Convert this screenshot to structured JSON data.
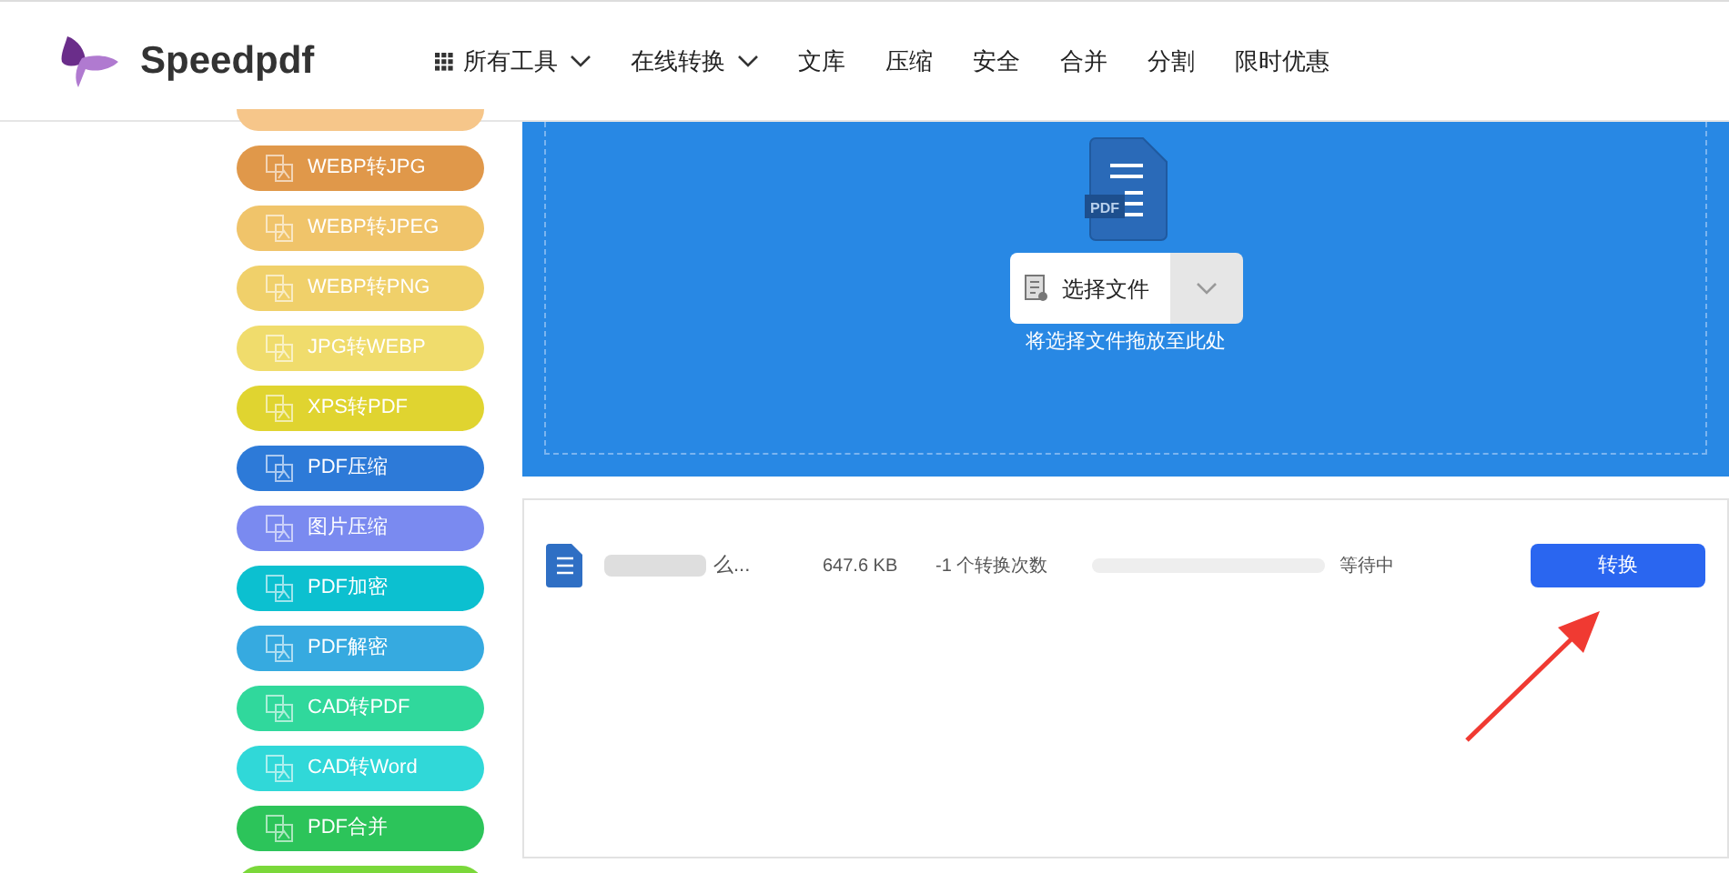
{
  "header": {
    "logo": "Speedpdf",
    "nav": [
      {
        "label": "所有工具",
        "kind": "grid-dropdown"
      },
      {
        "label": "在线转换",
        "kind": "dropdown"
      },
      {
        "label": "文库",
        "kind": "link"
      },
      {
        "label": "压缩",
        "kind": "link"
      },
      {
        "label": "安全",
        "kind": "link"
      },
      {
        "label": "合并",
        "kind": "link"
      },
      {
        "label": "分割",
        "kind": "link"
      },
      {
        "label": "限时优惠",
        "kind": "link"
      }
    ]
  },
  "sidebar": {
    "items": [
      {
        "label": "WEBP转JPG",
        "color": "#e0984a"
      },
      {
        "label": "WEBP转JPEG",
        "color": "#f0c46a"
      },
      {
        "label": "WEBP转PNG",
        "color": "#f0d06a"
      },
      {
        "label": "JPG转WEBP",
        "color": "#f0dc6c"
      },
      {
        "label": "XPS转PDF",
        "color": "#e0d430"
      },
      {
        "label": "PDF压缩",
        "color": "#2d7ad8"
      },
      {
        "label": "图片压缩",
        "color": "#7a8af0"
      },
      {
        "label": "PDF加密",
        "color": "#0cc0d0"
      },
      {
        "label": "PDF解密",
        "color": "#36aae0"
      },
      {
        "label": "CAD转PDF",
        "color": "#30d89c"
      },
      {
        "label": "CAD转Word",
        "color": "#30d8d8"
      },
      {
        "label": "PDF合并",
        "color": "#2cc45a"
      }
    ]
  },
  "upload": {
    "icon_label": "PDF",
    "button": "选择文件",
    "hint": "将选择文件拖放至此处"
  },
  "files": [
    {
      "name": "么...",
      "size": "647.6 KB",
      "conversions": "-1 个转换次数",
      "level": 0,
      "status": "等待中",
      "action": "转换"
    }
  ]
}
